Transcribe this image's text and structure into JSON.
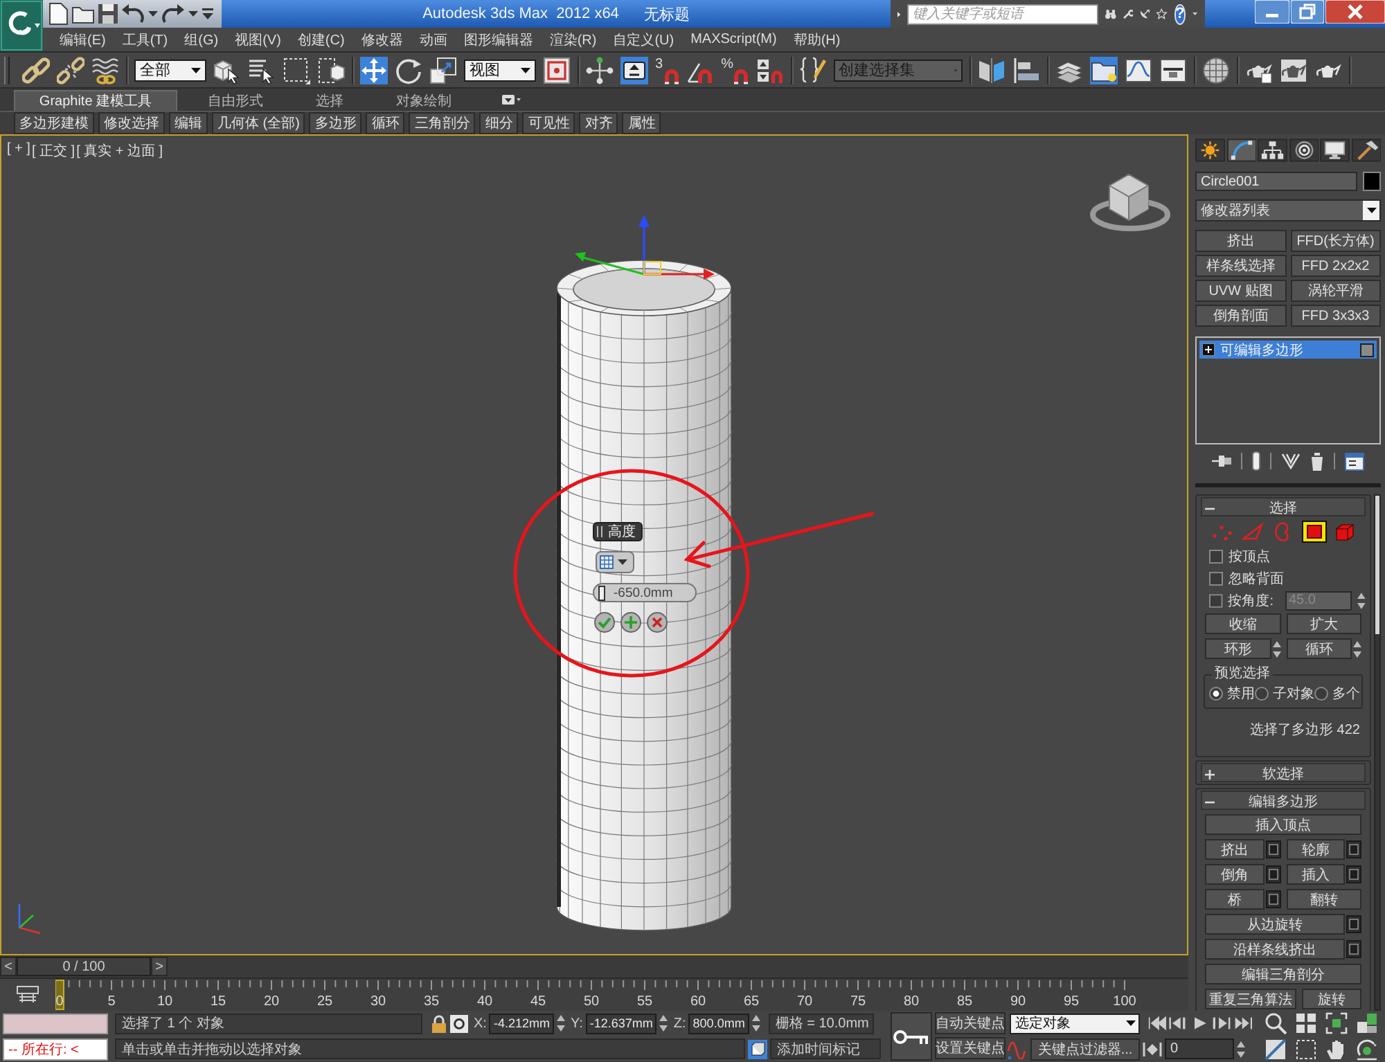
{
  "title_bar": {
    "title": "Autodesk 3ds Max  2012 x64",
    "document": "无标题",
    "search": {
      "placeholder": "键入关键字或短语"
    },
    "help": "?"
  },
  "menu": [
    "编辑(E)",
    "工具(T)",
    "组(G)",
    "视图(V)",
    "创建(C)",
    "修改器",
    "动画",
    "图形编辑器",
    "渲染(R)",
    "自定义(U)",
    "MAXScript(M)",
    "帮助(H)"
  ],
  "toolbar": {
    "groups": [
      [
        {
          "kind": "link",
          "selected": false
        },
        {
          "kind": "unlink",
          "selected": false
        },
        {
          "kind": "bind",
          "selected": false
        }
      ],
      [
        {
          "kind": "dropdown",
          "value": "全部"
        },
        {
          "kind": "select",
          "selected": false
        },
        {
          "kind": "select-by-name",
          "selected": false
        },
        {
          "kind": "region",
          "selected": false
        },
        {
          "kind": "crossing",
          "selected": false
        }
      ],
      [
        {
          "kind": "move",
          "selected": true
        },
        {
          "kind": "rotate",
          "selected": false
        },
        {
          "kind": "scale",
          "selected": false
        },
        {
          "kind": "dropdown",
          "value": "视图"
        },
        {
          "kind": "pivot",
          "selected": false
        }
      ],
      [
        {
          "kind": "manipulate",
          "selected": false
        },
        {
          "kind": "keyboard",
          "selected": true
        },
        {
          "kind": "snap",
          "label": "3",
          "selected": false
        },
        {
          "kind": "angle-snap",
          "selected": false
        },
        {
          "kind": "percent-snap",
          "label": "%",
          "selected": false
        },
        {
          "kind": "spinner-snap",
          "selected": false
        }
      ],
      [
        {
          "kind": "named-sets",
          "selected": false
        },
        {
          "kind": "combo",
          "placeholder": "创建选择集"
        }
      ],
      [
        {
          "kind": "mirror",
          "selected": false
        },
        {
          "kind": "align",
          "selected": false
        }
      ],
      [
        {
          "kind": "layers",
          "selected": false
        },
        {
          "kind": "ribbon",
          "selected": true
        },
        {
          "kind": "curve-editor",
          "selected": false
        },
        {
          "kind": "schematic",
          "selected": false
        }
      ],
      [
        {
          "kind": "material",
          "selected": false
        }
      ],
      [
        {
          "kind": "render-setup",
          "selected": false
        },
        {
          "kind": "frame-window",
          "selected": false
        },
        {
          "kind": "render",
          "selected": false
        }
      ]
    ]
  },
  "ribbon": {
    "tabs": [
      {
        "label": "Graphite 建模工具",
        "selected": true
      },
      {
        "label": "自由形式",
        "selected": false
      },
      {
        "label": "选择",
        "selected": false
      },
      {
        "label": "对象绘制",
        "selected": false
      }
    ],
    "panels": [
      "多边形建模",
      "修改选择",
      "编辑",
      "几何体 (全部)",
      "多边形",
      "循环",
      "三角剖分",
      "细分",
      "可见性",
      "对齐",
      "属性"
    ]
  },
  "viewport": {
    "active": true,
    "labels": [
      "[ + ]",
      "[ 正交 ]",
      "[ 真实 + 边面 ]"
    ],
    "caddy": {
      "title": "高度",
      "value": "-650.0mm"
    }
  },
  "command_panel": {
    "tabs": [
      {
        "kind": "create",
        "selected": false
      },
      {
        "kind": "modify",
        "selected": true
      },
      {
        "kind": "hierarchy",
        "selected": false
      },
      {
        "kind": "motion",
        "selected": false
      },
      {
        "kind": "display",
        "selected": false
      },
      {
        "kind": "utilities",
        "selected": false
      }
    ],
    "object_name": "Circle001",
    "modifier_list": "修改器列表",
    "modifier_buttons": [
      "挤出",
      "FFD(长方体)",
      "样条线选择",
      "FFD 2x2x2",
      "UVW 贴图",
      "涡轮平滑",
      "倒角剖面",
      "FFD 3x3x3"
    ],
    "stack": [
      {
        "label": "可编辑多边形",
        "selected": true,
        "expanded": false
      }
    ],
    "selection_rollout": {
      "title": "选择",
      "expanded": true,
      "subobjects": [
        {
          "kind": "vertex",
          "selected": false
        },
        {
          "kind": "edge",
          "selected": false
        },
        {
          "kind": "border",
          "selected": false
        },
        {
          "kind": "polygon",
          "selected": true
        },
        {
          "kind": "element",
          "selected": false
        }
      ],
      "checkboxes": [
        {
          "label": "按顶点",
          "checked": false
        },
        {
          "label": "忽略背面",
          "checked": false
        },
        {
          "label": "按角度:",
          "checked": false
        }
      ],
      "angle": {
        "value": "45.0",
        "disabled": true
      },
      "buttons": [
        "收缩",
        "扩大"
      ],
      "loop_buttons": [
        "环形",
        "循环"
      ],
      "preview": {
        "title": "预览选择",
        "options": [
          {
            "label": "禁用",
            "selected": true
          },
          {
            "label": "子对象",
            "selected": false
          },
          {
            "label": "多个",
            "selected": false
          }
        ]
      },
      "status": "选择了多边形 422"
    },
    "soft_selection_rollout": {
      "title": "软选择",
      "expanded": false
    },
    "edit_polygons_rollout": {
      "title": "编辑多边形",
      "expanded": true,
      "rows": [
        [
          {
            "label": "插入顶点",
            "settings": false
          }
        ],
        [
          {
            "label": "挤出",
            "settings": true
          },
          {
            "label": "轮廓",
            "settings": true
          }
        ],
        [
          {
            "label": "倒角",
            "settings": true
          },
          {
            "label": "插入",
            "settings": true
          }
        ],
        [
          {
            "label": "桥",
            "settings": true
          },
          {
            "label": "翻转",
            "settings": false
          }
        ],
        [
          {
            "label": "从边旋转",
            "settings": true
          }
        ],
        [
          {
            "label": "沿样条线挤出",
            "settings": true
          }
        ],
        [
          {
            "label": "编辑三角剖分",
            "settings": false
          }
        ],
        [
          {
            "label": "重复三角算法",
            "settings": false
          },
          {
            "label": "旋转",
            "settings": false
          }
        ]
      ]
    }
  },
  "time_slider": {
    "prev": "<",
    "position": "0 / 100",
    "next": ">",
    "level": 0
  },
  "track_bar": {
    "labels": [
      "0",
      "5",
      "10",
      "15",
      "20",
      "25",
      "30",
      "35",
      "40",
      "45",
      "50",
      "55",
      "60",
      "65",
      "70",
      "75",
      "80",
      "85",
      "90",
      "95",
      "100"
    ],
    "level": 0
  },
  "status_bar": {
    "listener": {
      "output": "-- 所在行: <"
    },
    "selection": "选择了 1 个 对象",
    "prompt": "单击或单击并拖动以选择对象",
    "coords": [
      {
        "axis": "X:",
        "value": "-4.212mm"
      },
      {
        "axis": "Y:",
        "value": "-12.637mm"
      },
      {
        "axis": "Z:",
        "value": "800.0mm"
      }
    ],
    "grid": "栅格 = 10.0mm",
    "time_tag": "添加时间标记",
    "auto_key": {
      "label": "自动关键点",
      "selected": false
    },
    "set_key": "设置关键点",
    "key_set": "选定对象",
    "key_filters": "关键点过滤器...",
    "frame": "0"
  }
}
